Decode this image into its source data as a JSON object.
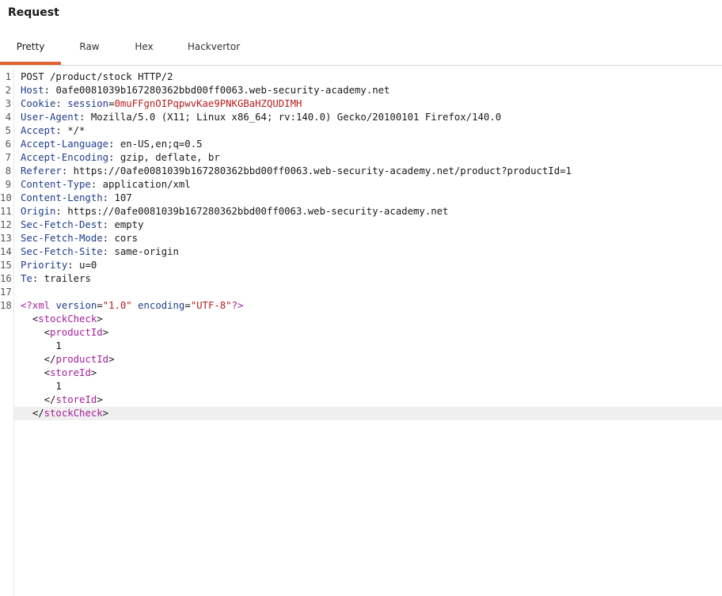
{
  "panel": {
    "title": "Request"
  },
  "tabs": [
    {
      "label": "Pretty",
      "active": true
    },
    {
      "label": "Raw",
      "active": false
    },
    {
      "label": "Hex",
      "active": false
    },
    {
      "label": "Hackvertor",
      "active": false
    }
  ],
  "colors": {
    "accent": "#e0622e",
    "header_name": "#1f3d8a",
    "cookie_value": "#b31f1f",
    "xml_tag": "#a51e9c"
  },
  "request": {
    "request_line": "POST /product/stock HTTP/2",
    "headers": [
      {
        "name": "Host",
        "value": "0afe0081039b167280362bbd00ff0063.web-security-academy.net"
      },
      {
        "name": "Cookie",
        "cookie_name": "session",
        "cookie_value": "0muFFgnOIPqpwvKae9PNKGBaHZQUDIMH"
      },
      {
        "name": "User-Agent",
        "value": "Mozilla/5.0 (X11; Linux x86_64; rv:140.0) Gecko/20100101 Firefox/140.0"
      },
      {
        "name": "Accept",
        "value": "*/*"
      },
      {
        "name": "Accept-Language",
        "value": "en-US,en;q=0.5"
      },
      {
        "name": "Accept-Encoding",
        "value": "gzip, deflate, br"
      },
      {
        "name": "Referer",
        "value": "https://0afe0081039b167280362bbd00ff0063.web-security-academy.net/product?productId=1"
      },
      {
        "name": "Content-Type",
        "value": "application/xml"
      },
      {
        "name": "Content-Length",
        "value": "107"
      },
      {
        "name": "Origin",
        "value": "https://0afe0081039b167280362bbd00ff0063.web-security-academy.net"
      },
      {
        "name": "Sec-Fetch-Dest",
        "value": "empty"
      },
      {
        "name": "Sec-Fetch-Mode",
        "value": "cors"
      },
      {
        "name": "Sec-Fetch-Site",
        "value": "same-origin"
      },
      {
        "name": "Priority",
        "value": "u=0"
      },
      {
        "name": "Te",
        "value": "trailers"
      }
    ],
    "body": {
      "xml_decl": {
        "version": "1.0",
        "encoding": "UTF-8"
      },
      "root_tag": "stockCheck",
      "fields": [
        {
          "tag": "productId",
          "value": "1"
        },
        {
          "tag": "storeId",
          "value": "1"
        }
      ]
    }
  }
}
